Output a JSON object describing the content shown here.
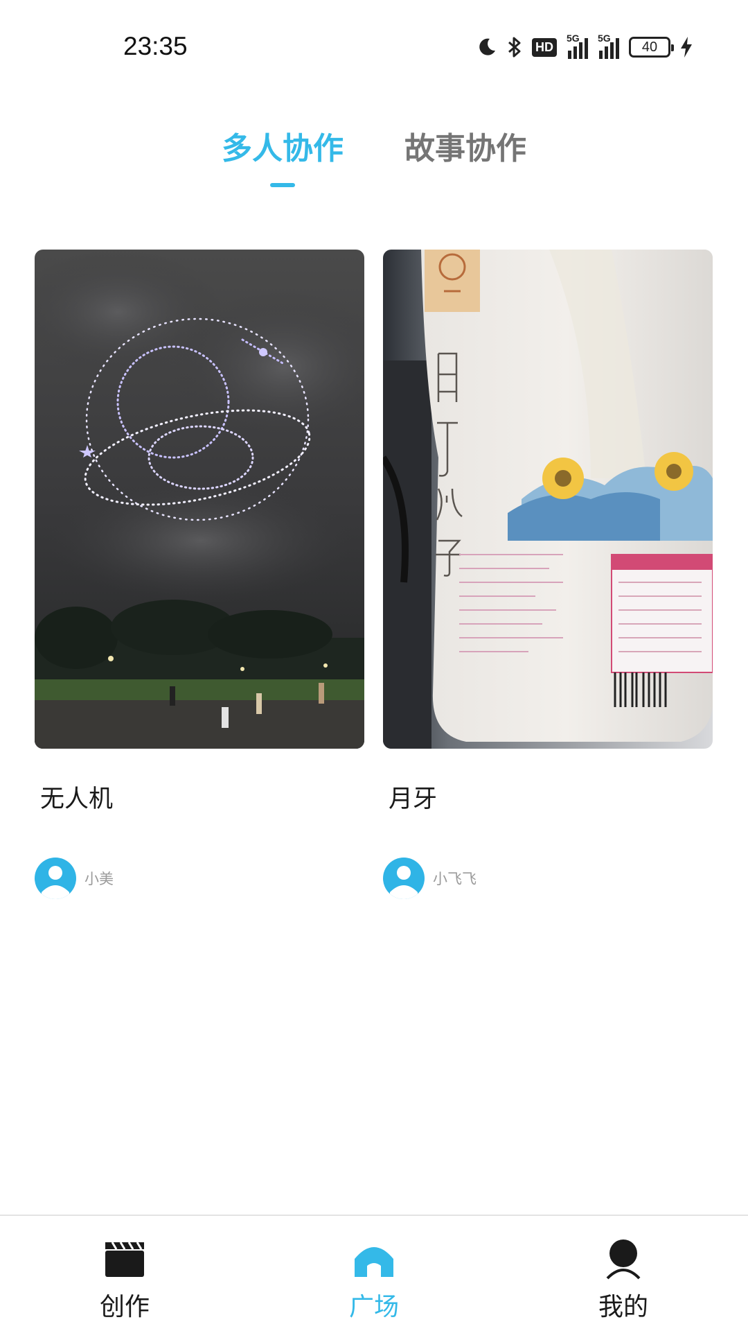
{
  "status_bar": {
    "time": "23:35",
    "hd_badge": "HD",
    "network_1": "5G",
    "network_2": "5G",
    "battery_level": "40",
    "icons": [
      "moon-icon",
      "bluetooth-icon",
      "hd-icon",
      "signal-icon",
      "signal-icon",
      "battery-icon",
      "charging-icon"
    ]
  },
  "tabs": [
    {
      "label": "多人协作",
      "active": true
    },
    {
      "label": "故事协作",
      "active": false
    }
  ],
  "accent_color": "#34B9E8",
  "posts": [
    {
      "title": "无人机",
      "author": "小美",
      "image": "drone-light-show-photo"
    },
    {
      "title": "月牙",
      "author": "小飞飞",
      "image": "sunflower-seed-bag-photo"
    }
  ],
  "bottom_nav": [
    {
      "label": "创作",
      "icon": "clapperboard-icon",
      "active": false
    },
    {
      "label": "广场",
      "icon": "home-icon",
      "active": true
    },
    {
      "label": "我的",
      "icon": "user-icon",
      "active": false
    }
  ]
}
